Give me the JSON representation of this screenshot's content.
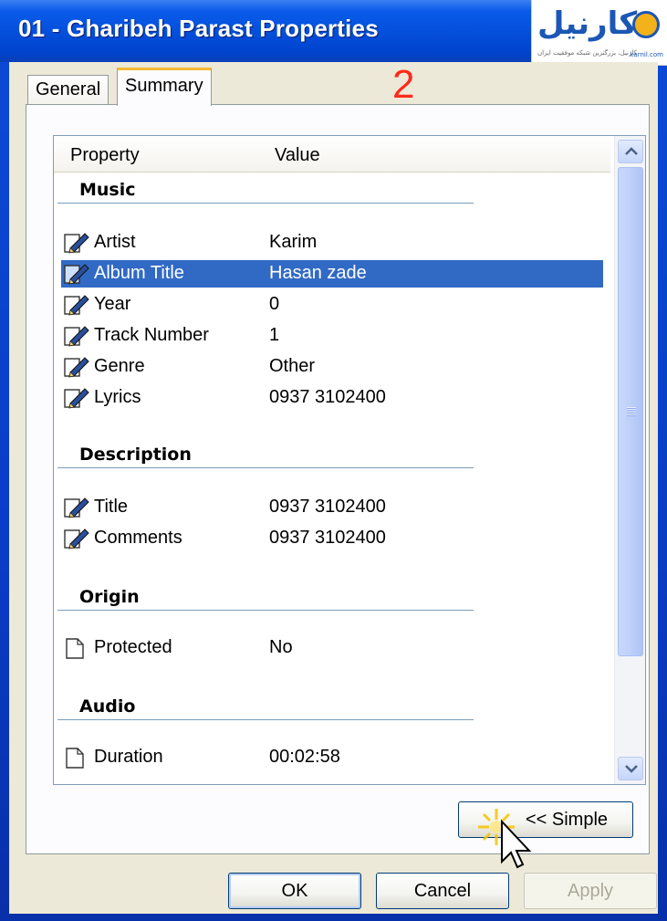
{
  "window": {
    "title": "01 - Gharibeh Parast Properties"
  },
  "logo": {
    "text": "کارنیل",
    "subtitle": "کارنیل، بزرگترین شبکه موفقیت ایران",
    "site": "karnil.com"
  },
  "annotation": {
    "step_number": "2"
  },
  "tabs": [
    {
      "label": "General",
      "active": false
    },
    {
      "label": "Summary",
      "active": true
    }
  ],
  "columns": {
    "property": "Property",
    "value": "Value"
  },
  "groups": {
    "music": {
      "title": "Music",
      "rows": [
        {
          "property": "Artist",
          "value": "Karim",
          "icon": "edit-icon"
        },
        {
          "property": "Album Title",
          "value": "Hasan zade",
          "icon": "edit-icon",
          "selected": true
        },
        {
          "property": "Year",
          "value": "0",
          "icon": "edit-icon"
        },
        {
          "property": "Track Number",
          "value": "1",
          "icon": "edit-icon"
        },
        {
          "property": "Genre",
          "value": "Other",
          "icon": "edit-icon"
        },
        {
          "property": "Lyrics",
          "value": "0937 3102400",
          "icon": "edit-icon"
        }
      ]
    },
    "description": {
      "title": "Description",
      "rows": [
        {
          "property": "Title",
          "value": "0937 3102400",
          "icon": "edit-icon"
        },
        {
          "property": "Comments",
          "value": "0937 3102400",
          "icon": "edit-icon"
        }
      ]
    },
    "origin": {
      "title": "Origin",
      "rows": [
        {
          "property": "Protected",
          "value": "No",
          "icon": "document-icon"
        }
      ]
    },
    "audio": {
      "title": "Audio",
      "rows": [
        {
          "property": "Duration",
          "value": "00:02:58",
          "icon": "document-icon"
        }
      ]
    }
  },
  "buttons": {
    "simple": "<< Simple",
    "ok": "OK",
    "cancel": "Cancel",
    "apply": "Apply"
  },
  "colors": {
    "selection": "#316ac5",
    "title_bar": "#0550dc",
    "dialog_bg": "#ece9d8",
    "group_line": "#7b9ebd",
    "annotation": "#ff2a1a"
  }
}
